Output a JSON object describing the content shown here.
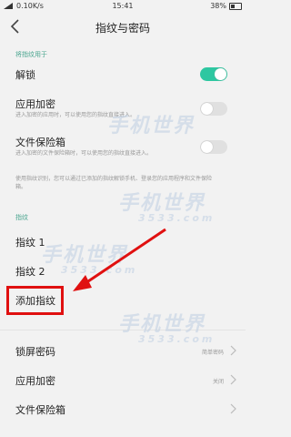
{
  "status": {
    "speed": "0.10K/s",
    "time": "15:41",
    "battery": "38%"
  },
  "header": {
    "title": "指纹与密码"
  },
  "sections": {
    "fingerprint_use": {
      "header": "将指纹用于",
      "unlock": {
        "label": "解锁",
        "on": true
      },
      "app_lock": {
        "label": "应用加密",
        "desc": "进入加密的应用时，可以使用您的指纹直接进入。",
        "on": false
      },
      "file_safe": {
        "label": "文件保险箱",
        "desc": "进入加密的文件保险箱时，可以使用您的指纹直接进入。",
        "on": false
      },
      "note": "使用指纹识别，您可以通过已添加的指纹解锁手机、登录您的应用程序和文件保险箱。"
    },
    "fingerprints": {
      "header": "指纹",
      "items": [
        "指纹 1",
        "指纹 2"
      ],
      "add": "添加指纹"
    },
    "menu": [
      {
        "label": "锁屏密码",
        "value": "简单密码"
      },
      {
        "label": "应用加密",
        "value": "关闭"
      },
      {
        "label": "文件保险箱",
        "value": ""
      }
    ]
  },
  "watermark": {
    "text": "手机世界",
    "sub": "3533.com"
  },
  "colors": {
    "accent": "#2ec7a1",
    "highlight": "#e01010",
    "section": "#4aa58f"
  },
  "icons": {
    "back": "chevron-left-icon",
    "chevron": "chevron-right-icon"
  }
}
